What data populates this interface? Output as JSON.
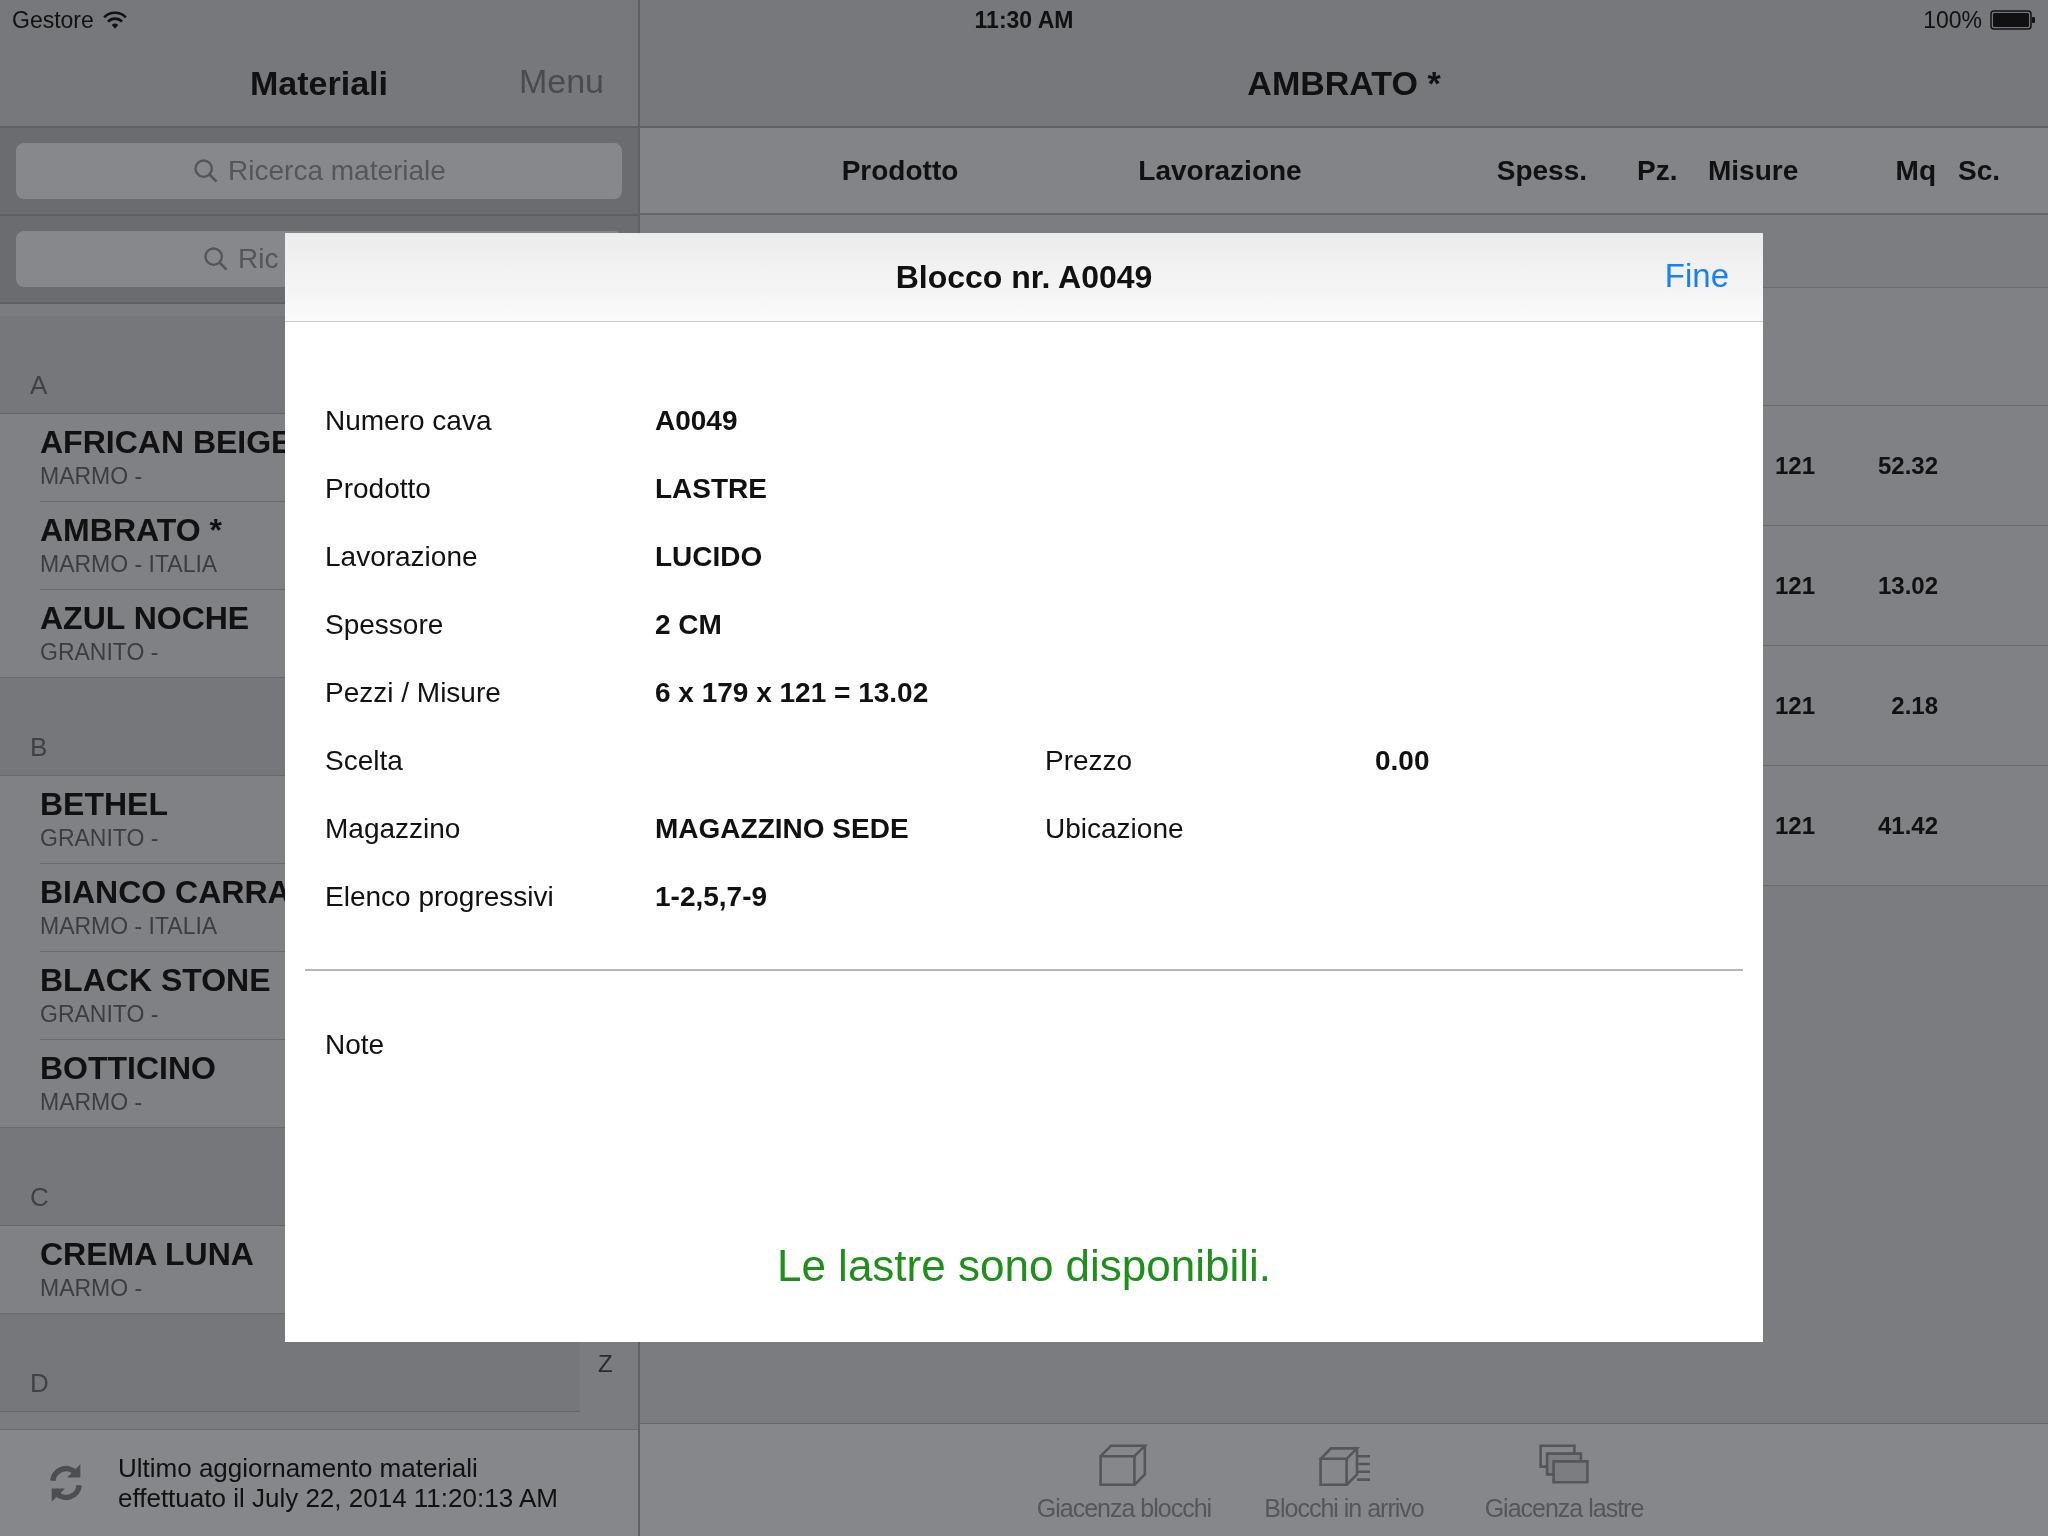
{
  "status_bar": {
    "carrier": "Gestore",
    "time": "11:30 AM",
    "battery": "100%"
  },
  "master": {
    "title": "Materiali",
    "menu_button": "Menu",
    "search_fields": [
      {
        "placeholder": "Ricerca materiale"
      },
      {
        "placeholder": "Ric"
      }
    ],
    "sections": [
      {
        "letter": "A",
        "items": [
          {
            "name": "AFRICAN BEIGE",
            "subtitle": "MARMO -"
          },
          {
            "name": "AMBRATO *",
            "subtitle": "MARMO - ITALIA"
          },
          {
            "name": "AZUL NOCHE",
            "subtitle": "GRANITO -"
          }
        ]
      },
      {
        "letter": "B",
        "items": [
          {
            "name": "BETHEL",
            "subtitle": "GRANITO -"
          },
          {
            "name": "BIANCO CARRA",
            "subtitle": "MARMO - ITALIA"
          },
          {
            "name": "BLACK STONE",
            "subtitle": "GRANITO -"
          },
          {
            "name": "BOTTICINO",
            "subtitle": "MARMO -"
          }
        ]
      },
      {
        "letter": "C",
        "items": [
          {
            "name": "CREMA LUNA",
            "subtitle": "MARMO -"
          }
        ]
      },
      {
        "letter": "D"
      }
    ],
    "index_letter": "Z",
    "footer": "Ultimo aggiornamento materiali effettuato il July 22, 2014 11:20:13 AM"
  },
  "detail": {
    "title": "AMBRATO *",
    "columns": [
      "Prodotto",
      "Lavorazione",
      "Spess.",
      "Pz.",
      "Misure",
      "Mq",
      "Sc."
    ],
    "rows": [
      {
        "misure": "121",
        "mq": "52.32"
      },
      {
        "misure": "121",
        "mq": "13.02"
      },
      {
        "misure": "121",
        "mq": "2.18"
      },
      {
        "misure": "121",
        "mq": "41.42"
      }
    ],
    "tab_bar": [
      {
        "kind": "box",
        "label": "Giacenza blocchi"
      },
      {
        "kind": "boxes",
        "label": "Blocchi in arrivo"
      },
      {
        "kind": "sheets",
        "label": "Giacenza lastre"
      }
    ]
  },
  "modal": {
    "title": "Blocco nr. A0049",
    "done_button": "Fine",
    "fields": [
      {
        "label": "Numero cava",
        "value": "A0049"
      },
      {
        "label": "Prodotto",
        "value": "LASTRE"
      },
      {
        "label": "Lavorazione",
        "value": "LUCIDO"
      },
      {
        "label": "Spessore",
        "value": "2 CM"
      },
      {
        "label": "Pezzi / Misure",
        "value": "6 x 179 x 121 = 13.02"
      },
      {
        "label": "Scelta",
        "label_2": "Prezzo",
        "value_2": "0.00"
      },
      {
        "label": "Magazzino",
        "value": "MAGAZZINO SEDE",
        "label_2": "Ubicazione"
      },
      {
        "label": "Elenco progressivi",
        "value": "1-2,5,7-9"
      }
    ],
    "note_label": "Note",
    "message": "Le lastre sono disponibili."
  }
}
